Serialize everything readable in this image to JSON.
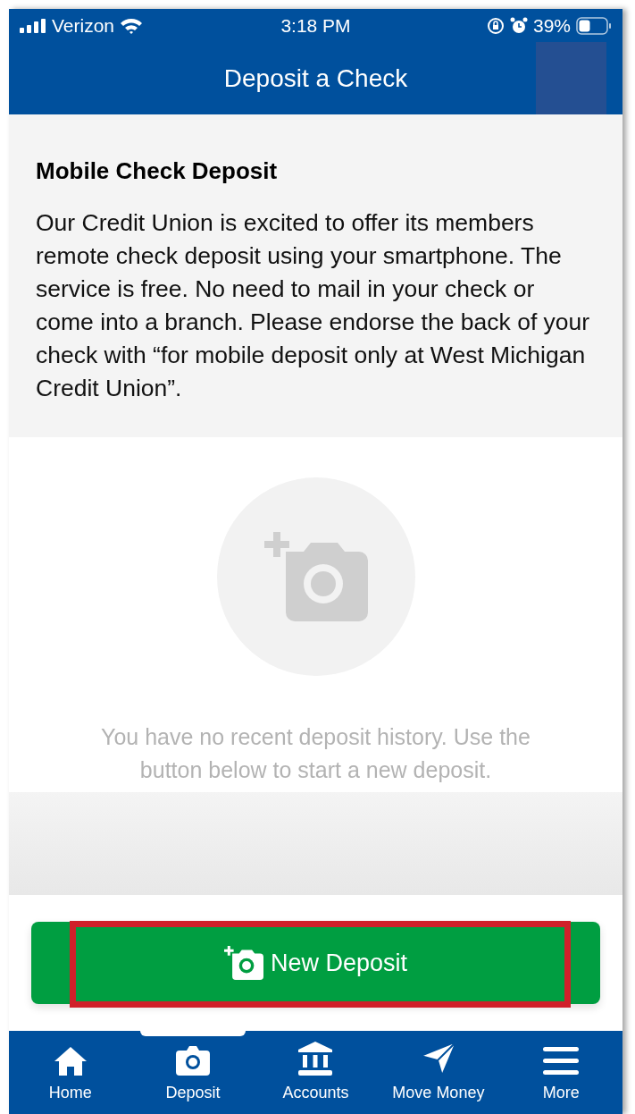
{
  "status_bar": {
    "carrier": "Verizon",
    "time": "3:18 PM",
    "battery": "39%"
  },
  "header": {
    "title": "Deposit a Check"
  },
  "intro": {
    "title": "Mobile Check Deposit",
    "body": "Our Credit Union is excited to offer its members remote check deposit using your smartphone. The service is free. No need to mail in your check or come into a branch.  Please endorse the back of your check with “for mobile deposit only at West Michigan Credit Union”."
  },
  "empty_state": {
    "message": "You have no recent deposit history. Use the button below to start a new deposit."
  },
  "primary_button": {
    "label": "New Deposit",
    "highlighted": true
  },
  "tab_bar": [
    {
      "label": "Home",
      "selected": false
    },
    {
      "label": "Deposit",
      "selected": true
    },
    {
      "label": "Accounts",
      "selected": false
    },
    {
      "label": "Move Money",
      "selected": false
    },
    {
      "label": "More",
      "selected": false
    }
  ]
}
